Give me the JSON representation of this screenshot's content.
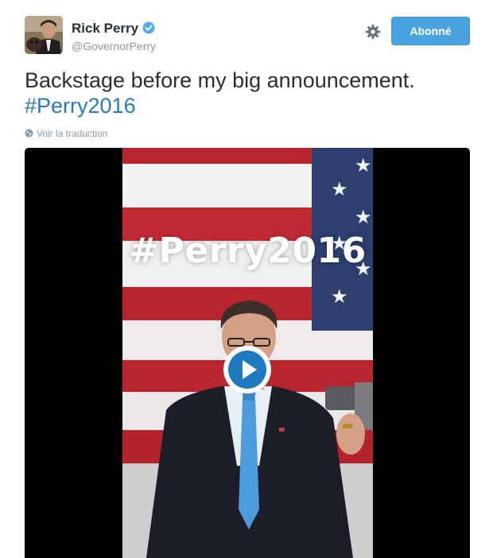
{
  "user": {
    "name": "Rick Perry",
    "handle": "@GovernorPerry",
    "avatar_icon": "avatar",
    "verified_icon": "verified-badge-icon",
    "verified_color": "#55acee"
  },
  "actions": {
    "settings_icon": "gear-icon",
    "follow_label": "Abonné",
    "follow_color": "#4aa3df"
  },
  "tweet": {
    "text": "Backstage before my big announcement.",
    "hashtag": "#Perry2016",
    "hashtag_color": "#2b7bb9"
  },
  "translate": {
    "icon": "globe-icon",
    "label": "Voir la traduction"
  },
  "media": {
    "type": "video",
    "overlay_text": "#Perry2016",
    "play_icon": "play-icon"
  }
}
